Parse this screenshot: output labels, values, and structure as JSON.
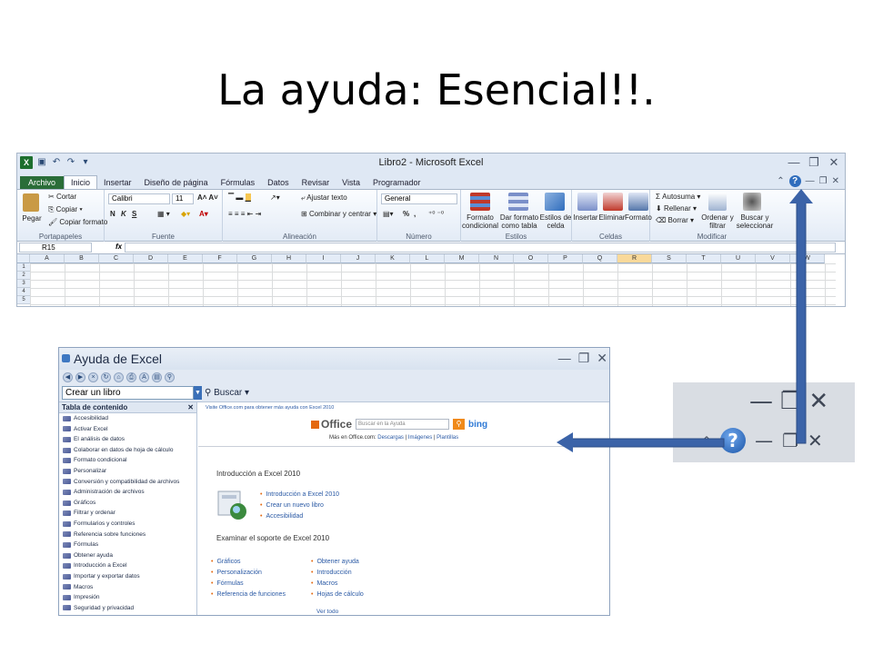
{
  "slide": {
    "title": "La ayuda: Esencial!!."
  },
  "excel": {
    "window_title": "Libro2 - Microsoft Excel",
    "tabs": [
      "Archivo",
      "Inicio",
      "Insertar",
      "Diseño de página",
      "Fórmulas",
      "Datos",
      "Revisar",
      "Vista",
      "Programador"
    ],
    "active_tab": "Inicio",
    "ribbon": {
      "clipboard": {
        "paste": "Pegar",
        "cut": "Cortar",
        "copy": "Copiar",
        "format_painter": "Copiar formato",
        "label": "Portapapeles"
      },
      "font": {
        "font_name": "Calibri",
        "font_size": "11",
        "bold": "N",
        "italic": "K",
        "underline": "S",
        "label": "Fuente"
      },
      "alignment": {
        "wrap": "Ajustar texto",
        "merge": "Combinar y centrar",
        "label": "Alineación"
      },
      "number": {
        "format": "General",
        "percent": "%",
        "comma": "000",
        "label": "Número"
      },
      "styles": {
        "conditional": "Formato condicional",
        "table": "Dar formato como tabla",
        "cell_styles": "Estilos de celda",
        "label": "Estilos"
      },
      "cells": {
        "insert": "Insertar",
        "delete": "Eliminar",
        "format": "Formato",
        "label": "Celdas"
      },
      "editing": {
        "autosum": "Autosuma",
        "fill": "Rellenar",
        "clear": "Borrar",
        "sort": "Ordenar y filtrar",
        "find": "Buscar y seleccionar",
        "label": "Modificar"
      }
    },
    "name_box": "R15",
    "fx": "fx",
    "columns": [
      "A",
      "B",
      "C",
      "D",
      "E",
      "F",
      "G",
      "H",
      "I",
      "J",
      "K",
      "L",
      "M",
      "N",
      "O",
      "P",
      "Q",
      "R",
      "S",
      "T",
      "U",
      "V",
      "W"
    ],
    "selected_column": "R",
    "rows": [
      "1",
      "2",
      "3",
      "4",
      "5"
    ]
  },
  "help": {
    "title": "Ayuda de Excel",
    "search_value": "Crear un libro",
    "search_button": "Buscar",
    "toc_title": "Tabla de contenido",
    "toc_items": [
      "Accesibilidad",
      "Activar Excel",
      "El análisis de datos",
      "Colaborar en datos de hoja de cálculo",
      "Formato condicional",
      "Personalizar",
      "Conversión y compatibilidad de archivos",
      "Administración de archivos",
      "Gráficos",
      "Filtrar y ordenar",
      "Formularios y controles",
      "Referencia sobre funciones",
      "Fórmulas",
      "Obtener ayuda",
      "Introducción a Excel",
      "Importar y exportar datos",
      "Macros",
      "Impresión",
      "Seguridad y privacidad"
    ],
    "top_link": "Visite Office.com para obtener más ayuda con Excel 2010",
    "office_label": "Office",
    "office_search_placeholder": "Buscar en la Ayuda",
    "bing": "bing",
    "more_office_prefix": "Más en Office.com:",
    "more_links": [
      "Descargas",
      "Imágenes",
      "Plantillas"
    ],
    "intro_title": "Introducción a Excel 2010",
    "intro_links": [
      "Introducción a Excel 2010",
      "Crear un nuevo libro",
      "Accesibilidad"
    ],
    "support_title": "Examinar el soporte de Excel 2010",
    "support_links_left": [
      "Gráficos",
      "Personalización",
      "Fórmulas",
      "Referencia de funciones"
    ],
    "support_links_right": [
      "Obtener ayuda",
      "Introducción",
      "Macros",
      "Hojas de cálculo"
    ],
    "see_all": "Ver todo"
  },
  "colors": {
    "file_tab": "#2a6d38",
    "help_blue": "#2f6dbd",
    "arrow": "#3b63a8",
    "link": "#2b5aa5"
  }
}
